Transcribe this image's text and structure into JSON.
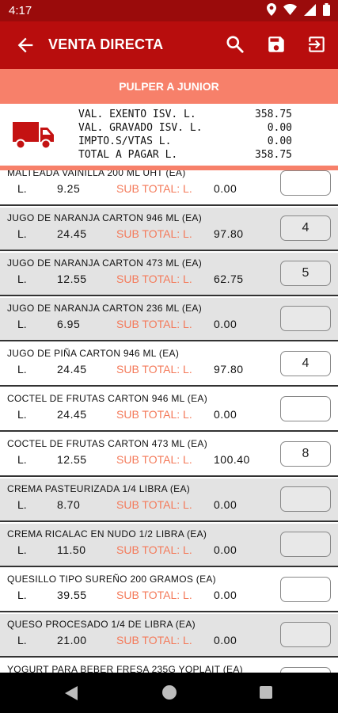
{
  "status": {
    "time": "4:17"
  },
  "app_bar": {
    "title": "VENTA DIRECTA"
  },
  "client": {
    "name": "PULPER A JUNIOR"
  },
  "summary": {
    "lines": [
      {
        "label": "VAL. EXENTO ISV. L.",
        "value": "358.75"
      },
      {
        "label": "VAL. GRAVADO ISV. L.",
        "value": "0.00"
      },
      {
        "label": "IMPTO.S/VTAS L.",
        "value": "0.00"
      },
      {
        "label": "TOTAL A PAGAR L.",
        "value": "358.75"
      }
    ]
  },
  "labels": {
    "currency": "L.",
    "subtotal": "SUB TOTAL: L."
  },
  "products": [
    {
      "name": "MALTEADA VAINILLA 200 ML UHT (EA)",
      "price": "9.25",
      "subtotal": "0.00",
      "qty": ""
    },
    {
      "name": "JUGO DE NARANJA CARTON 946 ML (EA)",
      "price": "24.45",
      "subtotal": "97.80",
      "qty": "4"
    },
    {
      "name": "JUGO DE NARANJA CARTON 473 ML (EA)",
      "price": "12.55",
      "subtotal": "62.75",
      "qty": "5"
    },
    {
      "name": "JUGO DE NARANJA CARTON 236 ML (EA)",
      "price": "6.95",
      "subtotal": "0.00",
      "qty": ""
    },
    {
      "name": "JUGO DE PIÑA CARTON 946 ML (EA)",
      "price": "24.45",
      "subtotal": "97.80",
      "qty": "4"
    },
    {
      "name": "COCTEL DE FRUTAS CARTON 946 ML (EA)",
      "price": "24.45",
      "subtotal": "0.00",
      "qty": ""
    },
    {
      "name": "COCTEL DE FRUTAS CARTON 473 ML (EA)",
      "price": "12.55",
      "subtotal": "100.40",
      "qty": "8"
    },
    {
      "name": "CREMA PASTEURIZADA 1/4 LIBRA (EA)",
      "price": "8.70",
      "subtotal": "0.00",
      "qty": ""
    },
    {
      "name": "CREMA RICALAC EN NUDO 1/2 LIBRA (EA)",
      "price": "11.50",
      "subtotal": "0.00",
      "qty": ""
    },
    {
      "name": "QUESILLO TIPO SUREÑO 200 GRAMOS (EA)",
      "price": "39.55",
      "subtotal": "0.00",
      "qty": ""
    },
    {
      "name": "QUESO PROCESADO 1/4 DE LIBRA (EA)",
      "price": "21.00",
      "subtotal": "0.00",
      "qty": ""
    },
    {
      "name": "YOGURT PARA BEBER FRESA 235G YOPLAIT (EA)",
      "price": "",
      "subtotal": "",
      "qty": ""
    }
  ],
  "colors": {
    "status_bar": "#9a0b0b",
    "app_bar": "#b80d0d",
    "client_bar": "#f7806a",
    "subtotal_label": "#f47a5a",
    "truck": "#c41212"
  }
}
